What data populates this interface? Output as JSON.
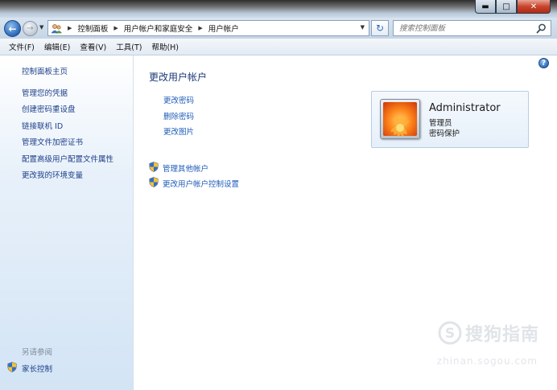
{
  "window": {
    "min_glyph": "▬",
    "max_glyph": "□",
    "close_glyph": "✕"
  },
  "address": {
    "crumbs": [
      "控制面板",
      "用户帐户和家庭安全",
      "用户帐户"
    ],
    "search_placeholder": "搜索控制面板"
  },
  "menu": [
    "文件(F)",
    "编辑(E)",
    "查看(V)",
    "工具(T)",
    "帮助(H)"
  ],
  "sidebar": {
    "home": "控制面板主页",
    "links": [
      "管理您的凭据",
      "创建密码重设盘",
      "链接联机 ID",
      "管理文件加密证书",
      "配置高级用户配置文件属性",
      "更改我的环境变量"
    ],
    "see_also": "另请参阅",
    "parental": "家长控制"
  },
  "main": {
    "title": "更改用户帐户",
    "tasks": [
      "更改密码",
      "删除密码",
      "更改图片"
    ],
    "shield_tasks": [
      "管理其他帐户",
      "更改用户帐户控制设置"
    ],
    "help_glyph": "?"
  },
  "user": {
    "name": "Administrator",
    "role": "管理员",
    "status": "密码保护"
  },
  "watermark": {
    "text": "搜狗指南",
    "url": "zhinan.sogou.com"
  },
  "colors": {
    "link": "#1d5bb8",
    "title": "#1c3a78",
    "sidebar_link": "#1d3f8a"
  }
}
